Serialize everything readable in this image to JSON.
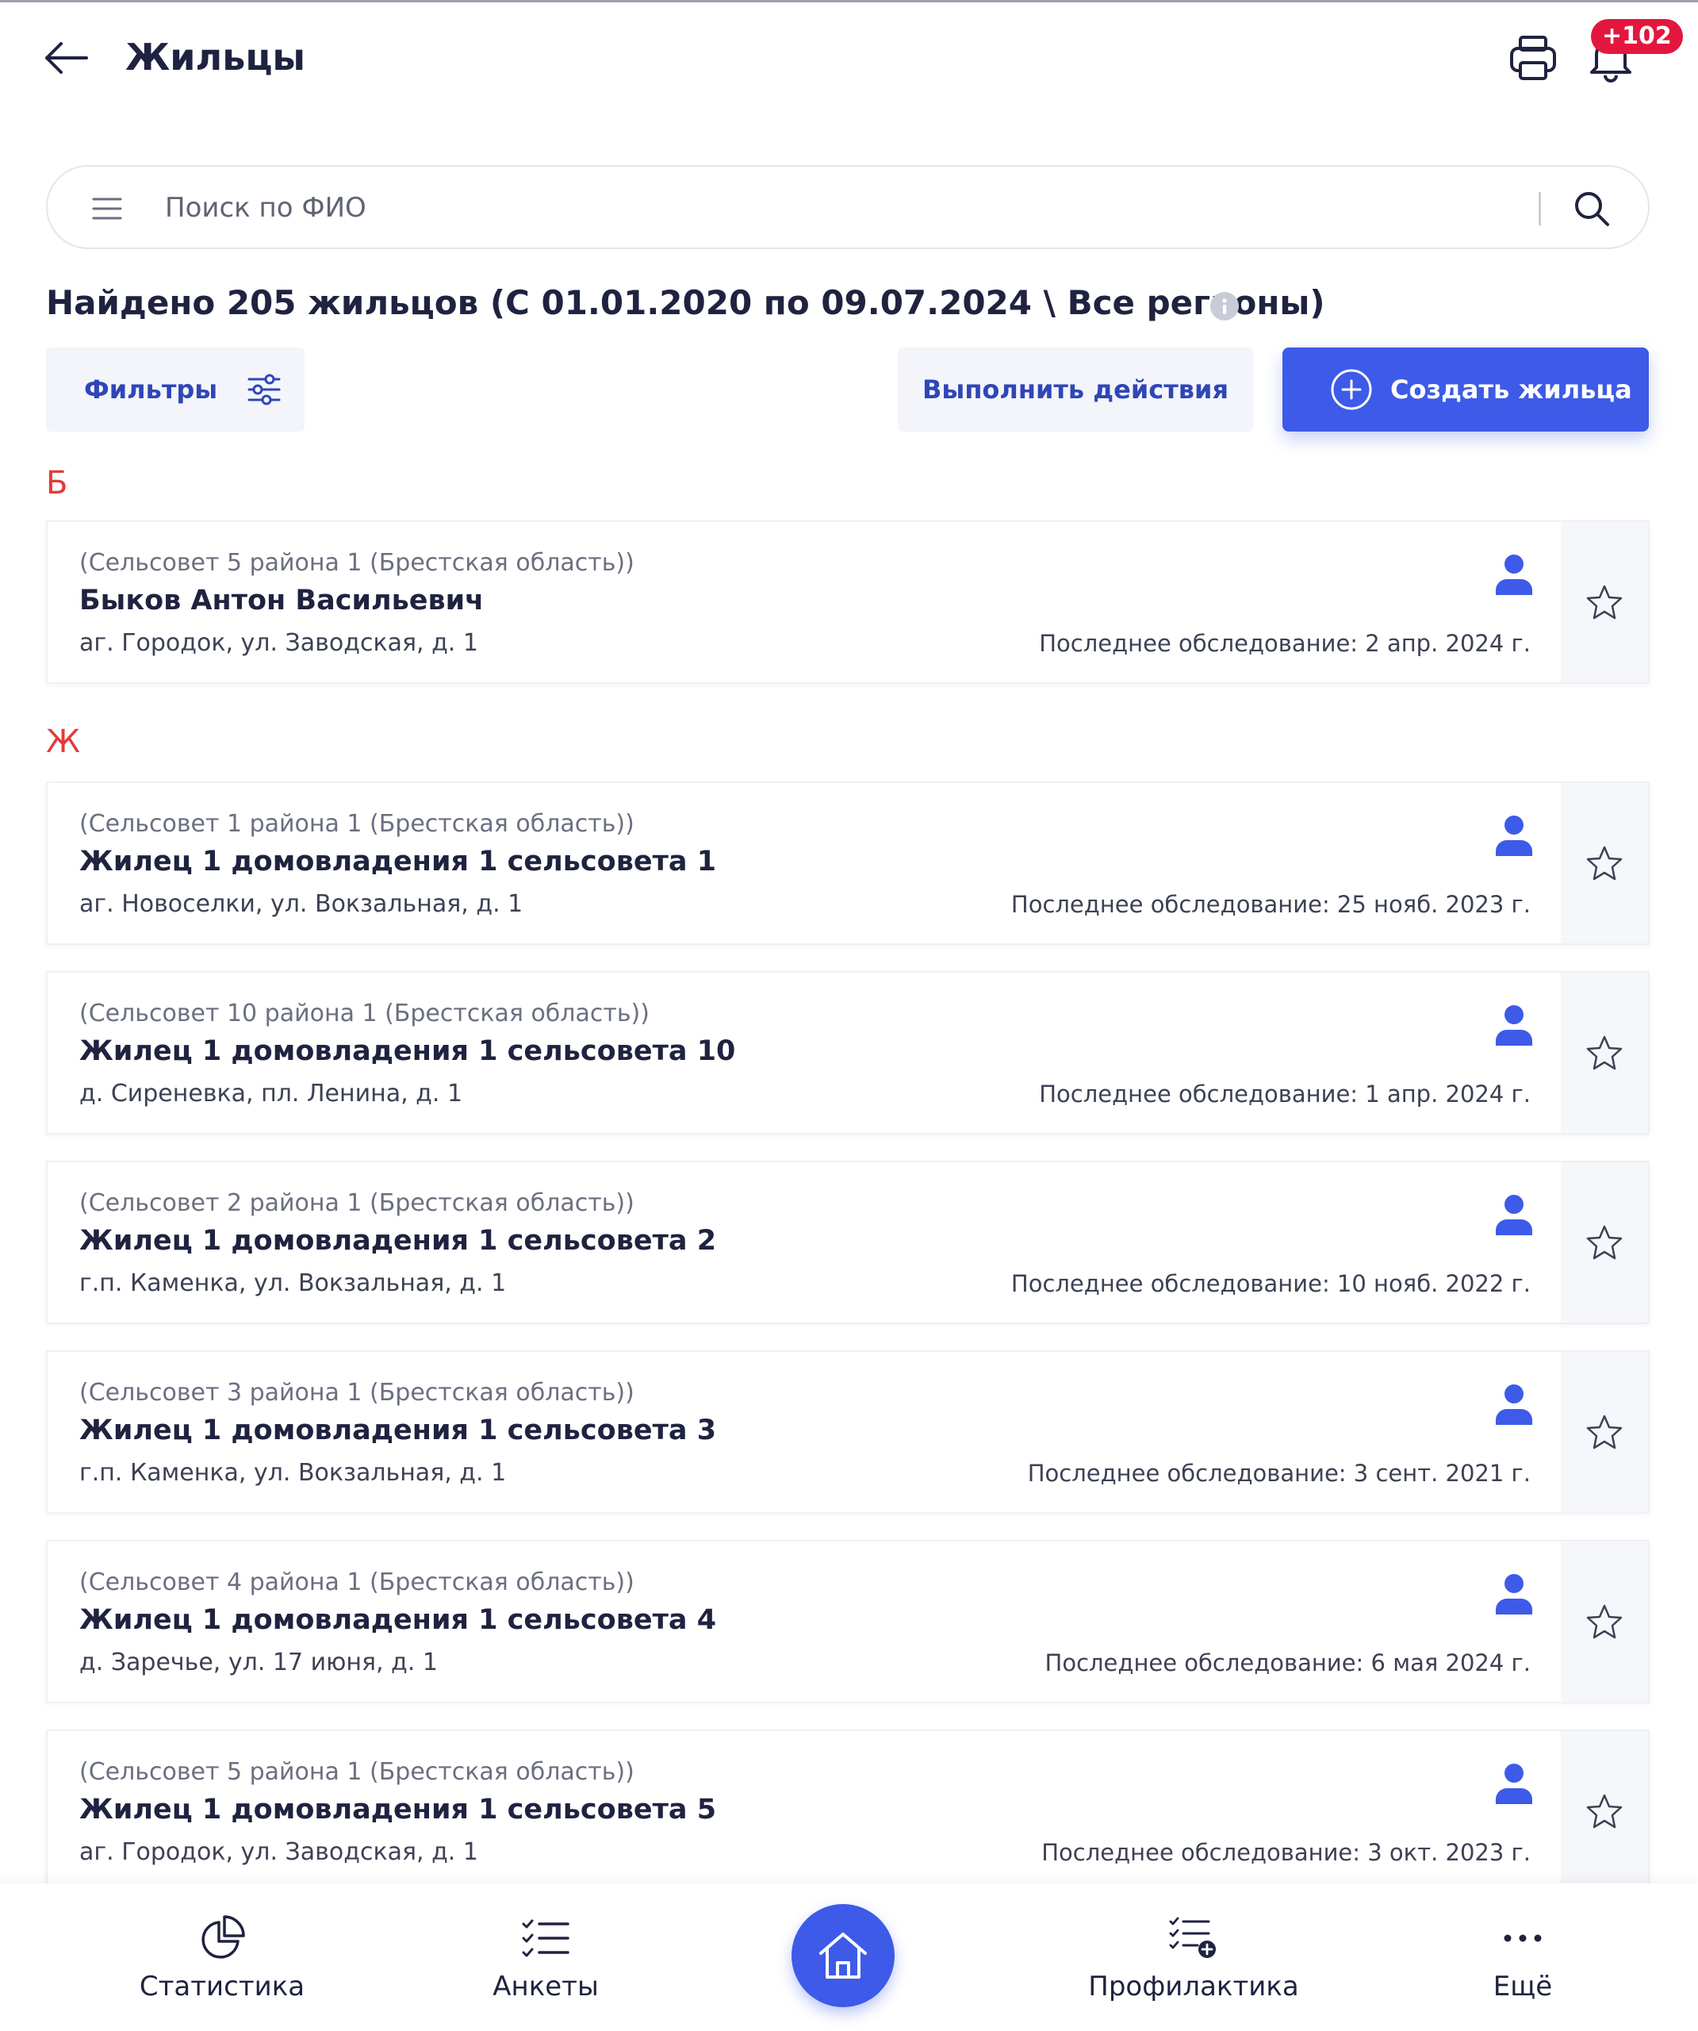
{
  "header": {
    "title": "Жильцы",
    "notifications_badge": "+102"
  },
  "search": {
    "placeholder": "Поиск по ФИО",
    "value": ""
  },
  "summary": {
    "found_text": "Найдено 205 жильцов (С 01.01.2020 по 09.07.2024 \\ Все регионы)"
  },
  "toolbar": {
    "filters_label": "Фильтры",
    "actions_label": "Выполнить действия",
    "create_label": "Создать жильца"
  },
  "groups": [
    {
      "letter": "Б",
      "residents": [
        {
          "region": "(Сельсовет 5 района 1 (Брестская область))",
          "name": "Быков Антон Васильевич",
          "address": "аг. Городок, ул. Заводская, д. 1",
          "last_survey": "Последнее обследование: 2 апр. 2024 г."
        }
      ]
    },
    {
      "letter": "Ж",
      "residents": [
        {
          "region": "(Сельсовет 1 района 1 (Брестская область))",
          "name": "Жилец 1 домовладения 1 сельсовета 1",
          "address": "аг. Новоселки, ул. Вокзальная, д. 1",
          "last_survey": "Последнее обследование: 25 нояб. 2023 г."
        },
        {
          "region": "(Сельсовет 10 района 1 (Брестская область))",
          "name": "Жилец 1 домовладения 1 сельсовета 10",
          "address": "д. Сиреневка, пл. Ленина, д. 1",
          "last_survey": "Последнее обследование: 1 апр. 2024 г."
        },
        {
          "region": "(Сельсовет 2 района 1 (Брестская область))",
          "name": "Жилец 1 домовладения 1 сельсовета 2",
          "address": "г.п. Каменка, ул. Вокзальная, д. 1",
          "last_survey": "Последнее обследование: 10 нояб. 2022 г."
        },
        {
          "region": "(Сельсовет 3 района 1 (Брестская область))",
          "name": "Жилец 1 домовладения 1 сельсовета 3",
          "address": "г.п. Каменка, ул. Вокзальная, д. 1",
          "last_survey": "Последнее обследование: 3 сент. 2021 г."
        },
        {
          "region": "(Сельсовет 4 района 1 (Брестская область))",
          "name": "Жилец 1 домовладения 1 сельсовета 4",
          "address": "д. Заречье, ул. 17 июня, д. 1",
          "last_survey": "Последнее обследование: 6 мая 2024 г."
        },
        {
          "region": "(Сельсовет 5 района 1 (Брестская область))",
          "name": "Жилец 1 домовладения 1 сельсовета 5",
          "address": "аг. Городок, ул. Заводская, д. 1",
          "last_survey": "Последнее обследование: 3 окт. 2023 г."
        }
      ]
    }
  ],
  "bottom_nav": {
    "statistics": "Статистика",
    "surveys": "Анкеты",
    "prevention": "Профилактика",
    "more": "Ещё"
  },
  "colors": {
    "accent": "#3d5be8",
    "link_text": "#2f46b8",
    "letter_header": "#e33a3a",
    "badge": "#e3173e"
  },
  "icons": {
    "back": "arrow-left-icon",
    "print": "printer-icon",
    "notifications": "bell-icon",
    "menu": "hamburger-icon",
    "search": "search-icon",
    "info": "info-icon",
    "filters": "sliders-icon",
    "create": "plus-circle-icon",
    "resident": "person-icon",
    "favorite": "star-icon",
    "statistics": "pie-chart-icon",
    "surveys": "checklist-icon",
    "home": "home-icon",
    "prevention": "checklist-plus-icon",
    "more": "dots-icon"
  }
}
